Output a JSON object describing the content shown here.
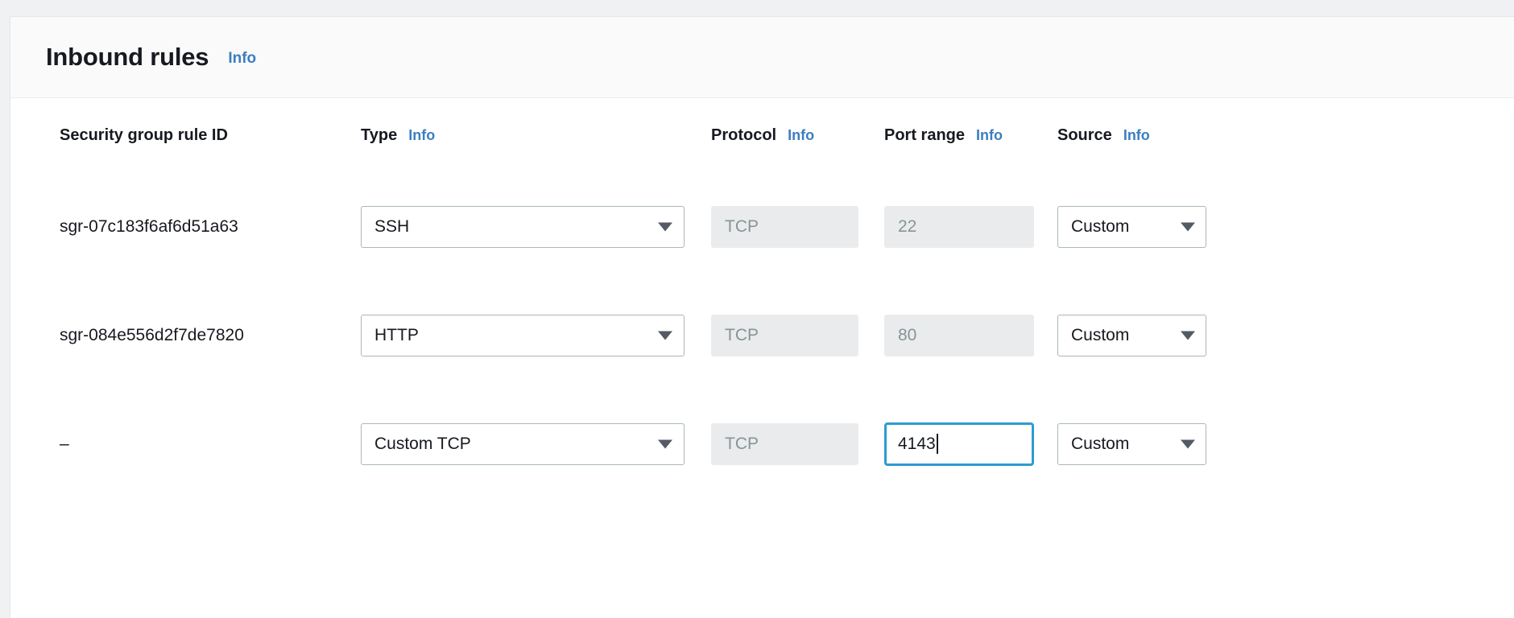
{
  "panel": {
    "title": "Inbound rules",
    "info_label": "Info"
  },
  "table": {
    "columns": [
      {
        "label": "Security group rule ID",
        "info": null
      },
      {
        "label": "Type",
        "info": "Info"
      },
      {
        "label": "Protocol",
        "info": "Info"
      },
      {
        "label": "Port range",
        "info": "Info"
      },
      {
        "label": "Source",
        "info": "Info"
      }
    ],
    "rows": [
      {
        "rule_id": "sgr-07c183f6af6d51a63",
        "type": "SSH",
        "protocol": "TCP",
        "port_range": "22",
        "source": "Custom",
        "port_focused": false
      },
      {
        "rule_id": "sgr-084e556d2f7de7820",
        "type": "HTTP",
        "protocol": "TCP",
        "port_range": "80",
        "source": "Custom",
        "port_focused": false
      },
      {
        "rule_id": "–",
        "type": "Custom TCP",
        "protocol": "TCP",
        "port_range": "4143",
        "source": "Custom",
        "port_focused": true
      }
    ]
  },
  "colors": {
    "accent_link": "#3b7ec0",
    "focus_border": "#2e9bd0",
    "disabled_bg": "#e9ebed",
    "disabled_text": "#879596",
    "text": "#16191f",
    "control_border": "#aab7b8",
    "page_bg": "#f0f1f2",
    "header_bg": "#fafafa"
  }
}
